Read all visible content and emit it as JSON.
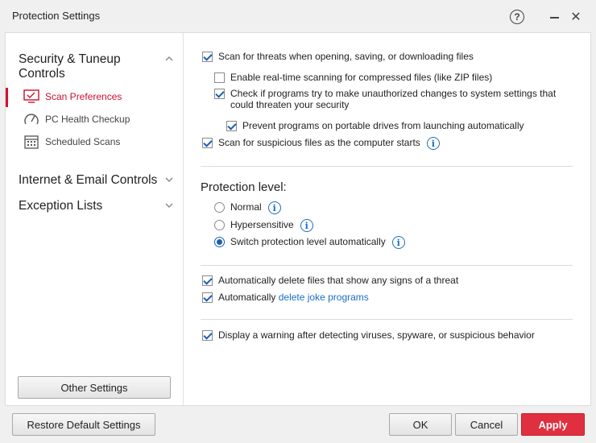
{
  "window": {
    "title": "Protection Settings",
    "help_icon": "help-icon",
    "minimize_icon": "minimize-icon",
    "close_icon": "close-icon"
  },
  "sidebar": {
    "sections": [
      {
        "label": "Security & Tuneup\nControls",
        "expanded": true
      },
      {
        "label": "Internet & Email Controls",
        "expanded": false
      },
      {
        "label": "Exception Lists",
        "expanded": false
      }
    ],
    "sub_items": [
      {
        "label": "Scan Preferences",
        "icon": "monitor-scan-icon",
        "active": true
      },
      {
        "label": "PC Health Checkup",
        "icon": "speedometer-icon",
        "active": false
      },
      {
        "label": "Scheduled Scans",
        "icon": "calendar-icon",
        "active": false
      }
    ],
    "other_settings_label": "Other Settings"
  },
  "content": {
    "scan_options": [
      {
        "label": "Scan for threats when opening, saving, or downloading files",
        "checked": true
      },
      {
        "label": "Enable real-time scanning for compressed files (like ZIP files)",
        "checked": false
      },
      {
        "label": "Check if programs try to make unauthorized changes to system settings that could threaten your security",
        "checked": true
      },
      {
        "label": "Prevent programs on portable drives from launching automatically",
        "checked": true
      },
      {
        "label": "Scan for suspicious files as the computer starts",
        "checked": true
      }
    ],
    "protection_level": {
      "heading": "Protection level:",
      "options": [
        {
          "label": "Normal",
          "selected": false
        },
        {
          "label": "Hypersensitive",
          "selected": false
        },
        {
          "label": "Switch protection level automatically",
          "selected": true
        }
      ]
    },
    "delete_options": {
      "auto_delete": {
        "label": "Automatically delete files that show any signs of a threat",
        "checked": true
      },
      "joke": {
        "prefix": "Automatically",
        "link": "delete joke programs",
        "checked": true
      }
    },
    "warning_option": {
      "label": "Display a warning after detecting viruses, spyware, or suspicious behavior",
      "checked": true
    }
  },
  "footer": {
    "restore_label": "Restore Default Settings",
    "ok_label": "OK",
    "cancel_label": "Cancel",
    "apply_label": "Apply"
  },
  "colors": {
    "accent": "#d4102e",
    "link": "#1a6fc4",
    "apply_button": "#e0303f"
  }
}
